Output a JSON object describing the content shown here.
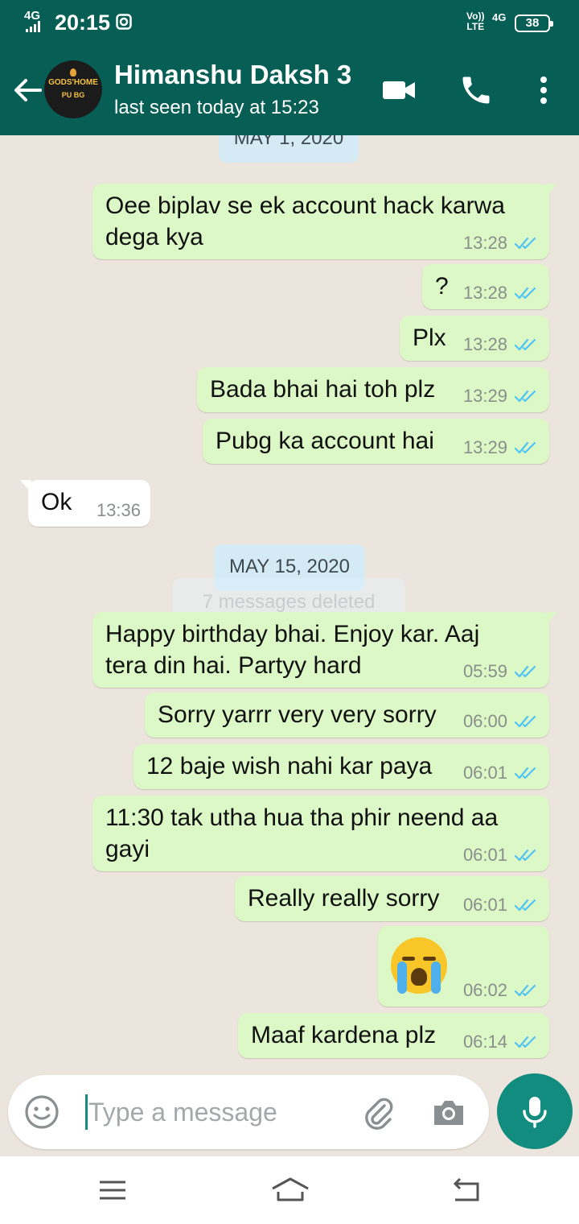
{
  "status_bar": {
    "network": "4G",
    "time": "20:15",
    "volte_top": "Vo))",
    "volte_bottom": "LTE",
    "lte_label": "4G",
    "battery": "38"
  },
  "header": {
    "contact_name": "Himanshu Daksh 3",
    "last_seen": "last seen today at 15:23",
    "avatar_text_top": "GODS'HOME",
    "avatar_text_bottom": "PU BG"
  },
  "chat": {
    "date_chip_1": "MAY 1, 2020",
    "date_chip_2": "MAY 15, 2020",
    "deleted_note": "7 messages deleted",
    "messages": [
      {
        "dir": "out",
        "line1": "Oee biplav se ek account hack karwa",
        "line2": "dega kya",
        "time": "13:28"
      },
      {
        "dir": "out",
        "line1": "?",
        "time": "13:28"
      },
      {
        "dir": "out",
        "line1": "Plx",
        "time": "13:28"
      },
      {
        "dir": "out",
        "line1": "Bada bhai hai toh plz",
        "time": "13:29"
      },
      {
        "dir": "out",
        "line1": "Pubg ka account hai",
        "time": "13:29"
      },
      {
        "dir": "in",
        "line1": "Ok",
        "time": "13:36"
      },
      {
        "dir": "out",
        "line1": "Happy birthday bhai. Enjoy kar. Aaj",
        "line2": "tera din hai. Partyy hard",
        "time": "05:59"
      },
      {
        "dir": "out",
        "line1": "Sorry yarrr very very sorry",
        "time": "06:00"
      },
      {
        "dir": "out",
        "line1": "12 baje wish nahi kar paya",
        "time": "06:01"
      },
      {
        "dir": "out",
        "line1": "11:30 tak utha hua tha phir neend aa",
        "line2": "gayi",
        "time": "06:01"
      },
      {
        "dir": "out",
        "line1": "Really really sorry",
        "time": "06:01"
      },
      {
        "dir": "out",
        "emoji": "loudly-crying-face",
        "time": "06:02"
      },
      {
        "dir": "out",
        "line1": "Maaf kardena plz",
        "time": "06:14"
      }
    ]
  },
  "composer": {
    "placeholder": "Type a message"
  },
  "colors": {
    "header_bg": "#075e54",
    "accent": "#128c7e",
    "outgoing_bubble": "#dcf8c6",
    "incoming_bubble": "#ffffff",
    "chat_bg": "#ece5dd",
    "date_chip": "#d4eaf4",
    "read_tick": "#4fc3f7"
  },
  "icons": [
    "back-arrow-icon",
    "video-call-icon",
    "phone-icon",
    "more-options-icon",
    "emoji-icon",
    "attach-icon",
    "camera-icon",
    "mic-icon",
    "read-receipt-icon",
    "menu-icon",
    "home-icon",
    "back-nav-icon"
  ]
}
